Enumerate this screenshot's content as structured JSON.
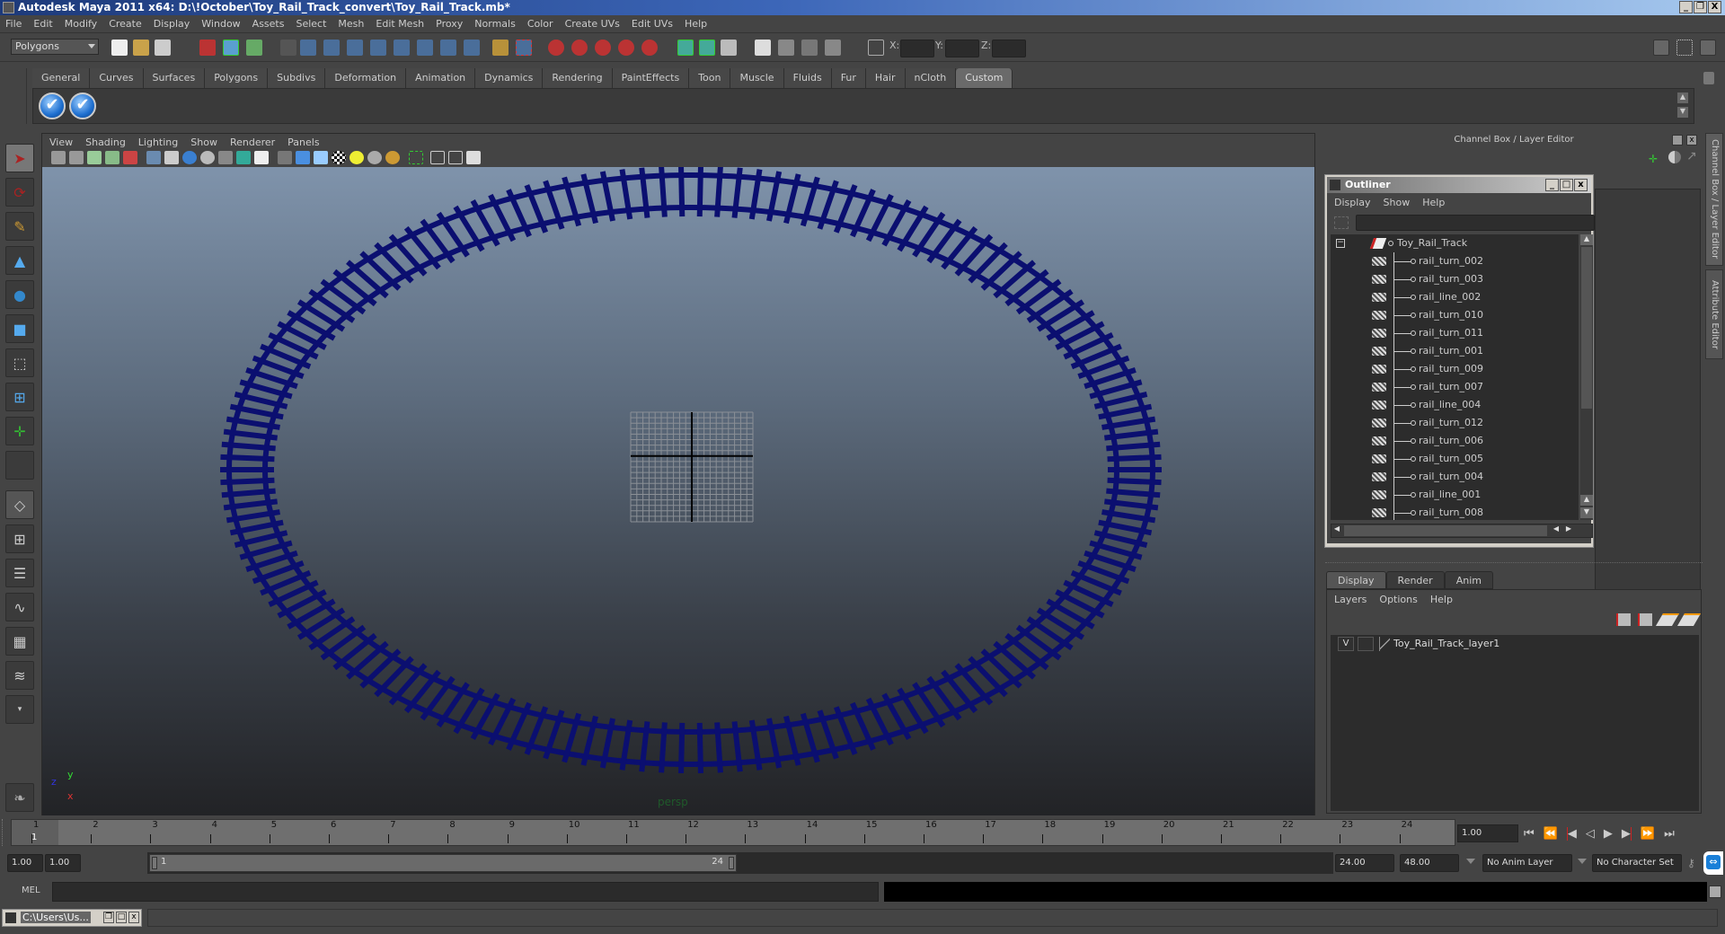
{
  "window": {
    "title": "Autodesk Maya 2011 x64: D:\\!October\\Toy_Rail_Track_convert\\Toy_Rail_Track.mb*",
    "controls": [
      "_",
      "❐",
      "X"
    ]
  },
  "menubar": [
    "File",
    "Edit",
    "Modify",
    "Create",
    "Display",
    "Window",
    "Assets",
    "Select",
    "Mesh",
    "Edit Mesh",
    "Proxy",
    "Normals",
    "Color",
    "Create UVs",
    "Edit UVs",
    "Help"
  ],
  "statusline": {
    "mode": "Polygons",
    "x_label": "X:",
    "y_label": "Y:",
    "z_label": "Z:",
    "x_value": "",
    "y_value": "",
    "z_value": ""
  },
  "shelf": {
    "tabs": [
      "General",
      "Curves",
      "Surfaces",
      "Polygons",
      "Subdivs",
      "Deformation",
      "Animation",
      "Dynamics",
      "Rendering",
      "PaintEffects",
      "Toon",
      "Muscle",
      "Fluids",
      "Fur",
      "Hair",
      "nCloth",
      "Custom"
    ],
    "active_tab": "Custom",
    "buttons": [
      "checkmark-icon",
      "checkmark-icon"
    ]
  },
  "viewport": {
    "menu": [
      "View",
      "Shading",
      "Lighting",
      "Show",
      "Renderer",
      "Panels"
    ],
    "camera_label": "persp",
    "axis": {
      "x": "x",
      "y": "y",
      "z": "z"
    },
    "track_color": "#0b0f70"
  },
  "channel_box": {
    "title": "Channel Box / Layer Editor",
    "side_tabs": [
      "Channel Box / Layer Editor",
      "Attribute Editor"
    ]
  },
  "outliner": {
    "title": "Outliner",
    "menu": [
      "Display",
      "Show",
      "Help"
    ],
    "filter_value": "",
    "root": "Toy_Rail_Track",
    "items": [
      "rail_turn_002",
      "rail_turn_003",
      "rail_line_002",
      "rail_turn_010",
      "rail_turn_011",
      "rail_turn_001",
      "rail_turn_009",
      "rail_turn_007",
      "rail_line_004",
      "rail_turn_012",
      "rail_turn_006",
      "rail_turn_005",
      "rail_turn_004",
      "rail_line_001",
      "rail_turn_008"
    ]
  },
  "layer_editor": {
    "tabs": [
      "Display",
      "Render",
      "Anim"
    ],
    "active_tab": "Display",
    "menu": [
      "Layers",
      "Options",
      "Help"
    ],
    "layers": [
      {
        "visible": "V",
        "name": "Toy_Rail_Track_layer1"
      }
    ]
  },
  "timeline": {
    "ticks": [
      "1",
      "2",
      "3",
      "4",
      "5",
      "6",
      "7",
      "8",
      "9",
      "10",
      "11",
      "12",
      "13",
      "14",
      "15",
      "16",
      "17",
      "18",
      "19",
      "20",
      "21",
      "22",
      "23",
      "24"
    ],
    "current_marker": "1",
    "current_frame": "1.00"
  },
  "range": {
    "start_time": "1.00",
    "playback_start": "1.00",
    "slider_start": "1",
    "slider_end": "24",
    "playback_end": "24.00",
    "end_time": "48.00",
    "anim_layer": "No Anim Layer",
    "character_set": "No Character Set"
  },
  "command_line": {
    "label": "MEL",
    "input": "",
    "output": ""
  },
  "minimized_window": {
    "title": "C:\\Users\\Us..."
  }
}
